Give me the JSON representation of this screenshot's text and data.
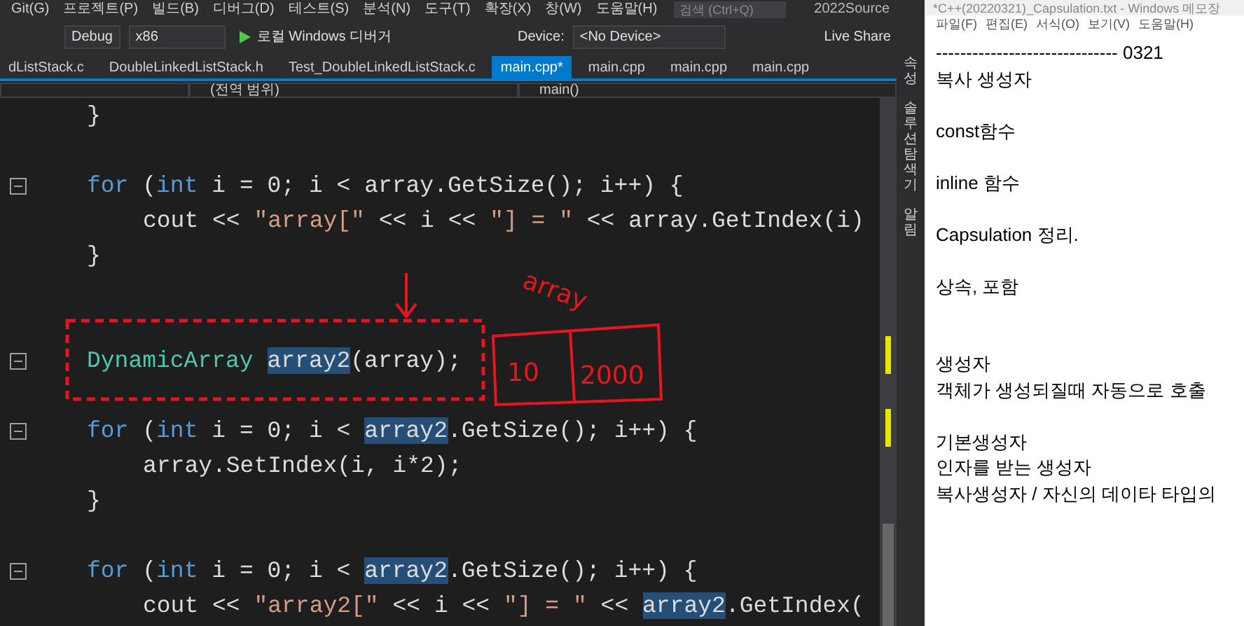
{
  "ide": {
    "window_title": "2022Source",
    "menu": [
      "Git(G)",
      "프로젝트(P)",
      "빌드(B)",
      "디버그(D)",
      "테스트(S)",
      "분석(N)",
      "도구(T)",
      "확장(X)",
      "창(W)",
      "도움말(H)"
    ],
    "search": {
      "placeholder": "검색 (Ctrl+Q)"
    },
    "toolbar": {
      "configuration": "Debug",
      "platform": "x86",
      "run_label": "로컬 Windows 디버거",
      "device_label": "Device:",
      "device": "<No Device>",
      "live_share": "Live Share"
    },
    "tabs": [
      {
        "label": "dListStack.c",
        "selected": false
      },
      {
        "label": "DoubleLinkedListStack.h",
        "selected": false
      },
      {
        "label": "Test_DoubleLinkedListStack.c",
        "selected": false
      },
      {
        "label": "main.cpp*",
        "selected": true
      },
      {
        "label": "main.cpp",
        "selected": false
      },
      {
        "label": "main.cpp",
        "selected": false
      },
      {
        "label": "main.cpp",
        "selected": false
      }
    ],
    "navigation": {
      "scope": "(전역 범위)",
      "member": "main()"
    },
    "code": [
      {
        "kind": "code",
        "fold": false,
        "tokens": [
          {
            "text": "}",
            "kind": "plain"
          }
        ]
      },
      {
        "kind": "blank"
      },
      {
        "kind": "code",
        "fold": true,
        "tokens": [
          {
            "text": "for",
            "kind": "keyword"
          },
          {
            "text": " (",
            "kind": "plain"
          },
          {
            "text": "int",
            "kind": "keyword"
          },
          {
            "text": " i = 0; i < array.GetSize(); i++) {",
            "kind": "plain"
          }
        ],
        "children": [
          {
            "kind": "code",
            "fold": false,
            "tokens": [
              {
                "text": "cout << ",
                "kind": "plain"
              },
              {
                "text": "\"array[\"",
                "kind": "string"
              },
              {
                "text": " << i << ",
                "kind": "plain"
              },
              {
                "text": "\"] = \"",
                "kind": "string"
              },
              {
                "text": " << array.GetIndex(i)",
                "kind": "plain"
              }
            ]
          }
        ]
      },
      {
        "kind": "code",
        "fold": false,
        "tokens": [
          {
            "text": "}",
            "kind": "plain"
          }
        ]
      },
      {
        "kind": "blank"
      },
      {
        "kind": "blank"
      },
      {
        "kind": "code",
        "fold": true,
        "tokens": [
          {
            "text": "DynamicArray ",
            "kind": "type"
          },
          {
            "text": "array2",
            "kind": "highlight"
          },
          {
            "text": "(array);",
            "kind": "plain"
          }
        ]
      },
      {
        "kind": "blank"
      },
      {
        "kind": "code",
        "fold": true,
        "tokens": [
          {
            "text": "for",
            "kind": "keyword"
          },
          {
            "text": " (",
            "kind": "plain"
          },
          {
            "text": "int",
            "kind": "keyword"
          },
          {
            "text": " i = 0; i < ",
            "kind": "plain"
          },
          {
            "text": "array2",
            "kind": "highlight"
          },
          {
            "text": ".GetSize(); i++) {",
            "kind": "plain"
          }
        ],
        "children": [
          {
            "kind": "code",
            "fold": false,
            "tokens": [
              {
                "text": "array.SetIndex(i, i*2);",
                "kind": "plain"
              }
            ]
          }
        ]
      },
      {
        "kind": "code",
        "fold": false,
        "tokens": [
          {
            "text": "}",
            "kind": "plain"
          }
        ]
      },
      {
        "kind": "blank"
      },
      {
        "kind": "code",
        "fold": true,
        "tokens": [
          {
            "text": "for",
            "kind": "keyword"
          },
          {
            "text": " (",
            "kind": "plain"
          },
          {
            "text": "int",
            "kind": "keyword"
          },
          {
            "text": " i = 0; i < ",
            "kind": "plain"
          },
          {
            "text": "array2",
            "kind": "highlight"
          },
          {
            "text": ".GetSize(); i++) {",
            "kind": "plain"
          }
        ],
        "children": [
          {
            "kind": "code",
            "fold": false,
            "tokens": [
              {
                "text": "cout << ",
                "kind": "plain"
              },
              {
                "text": "\"array2[\"",
                "kind": "string"
              },
              {
                "text": " << i << ",
                "kind": "plain"
              },
              {
                "text": "\"] = \"",
                "kind": "string"
              },
              {
                "text": " << ",
                "kind": "plain"
              },
              {
                "text": "array2",
                "kind": "highlight"
              },
              {
                "text": ".GetIndex(",
                "kind": "plain"
              }
            ]
          }
        ]
      }
    ],
    "side_panels": [
      "속성",
      "솔루션 탐색기",
      "알림"
    ]
  },
  "notepad": {
    "title": "*C++(20220321)_Capsulation.txt - Windows 메모장",
    "menu": [
      "파일(F)",
      "편집(E)",
      "서식(O)",
      "보기(V)",
      "도움말(H)"
    ],
    "paragraphs": [
      [
        "------------------------------ 0321",
        "복사 생성자"
      ],
      [
        "const함수"
      ],
      [
        "inline 함수"
      ],
      [
        "Capsulation 정리."
      ],
      [
        "상속, 포함"
      ],
      [
        "생성자",
        "객체가 생성되질때 자동으로 호출"
      ],
      [
        "기본생성자",
        "인자를 받는 생성자",
        "복사생성자 / 자신의 데이타 타입의"
      ]
    ]
  },
  "handwriting": [
    "array",
    "10",
    "2000"
  ]
}
